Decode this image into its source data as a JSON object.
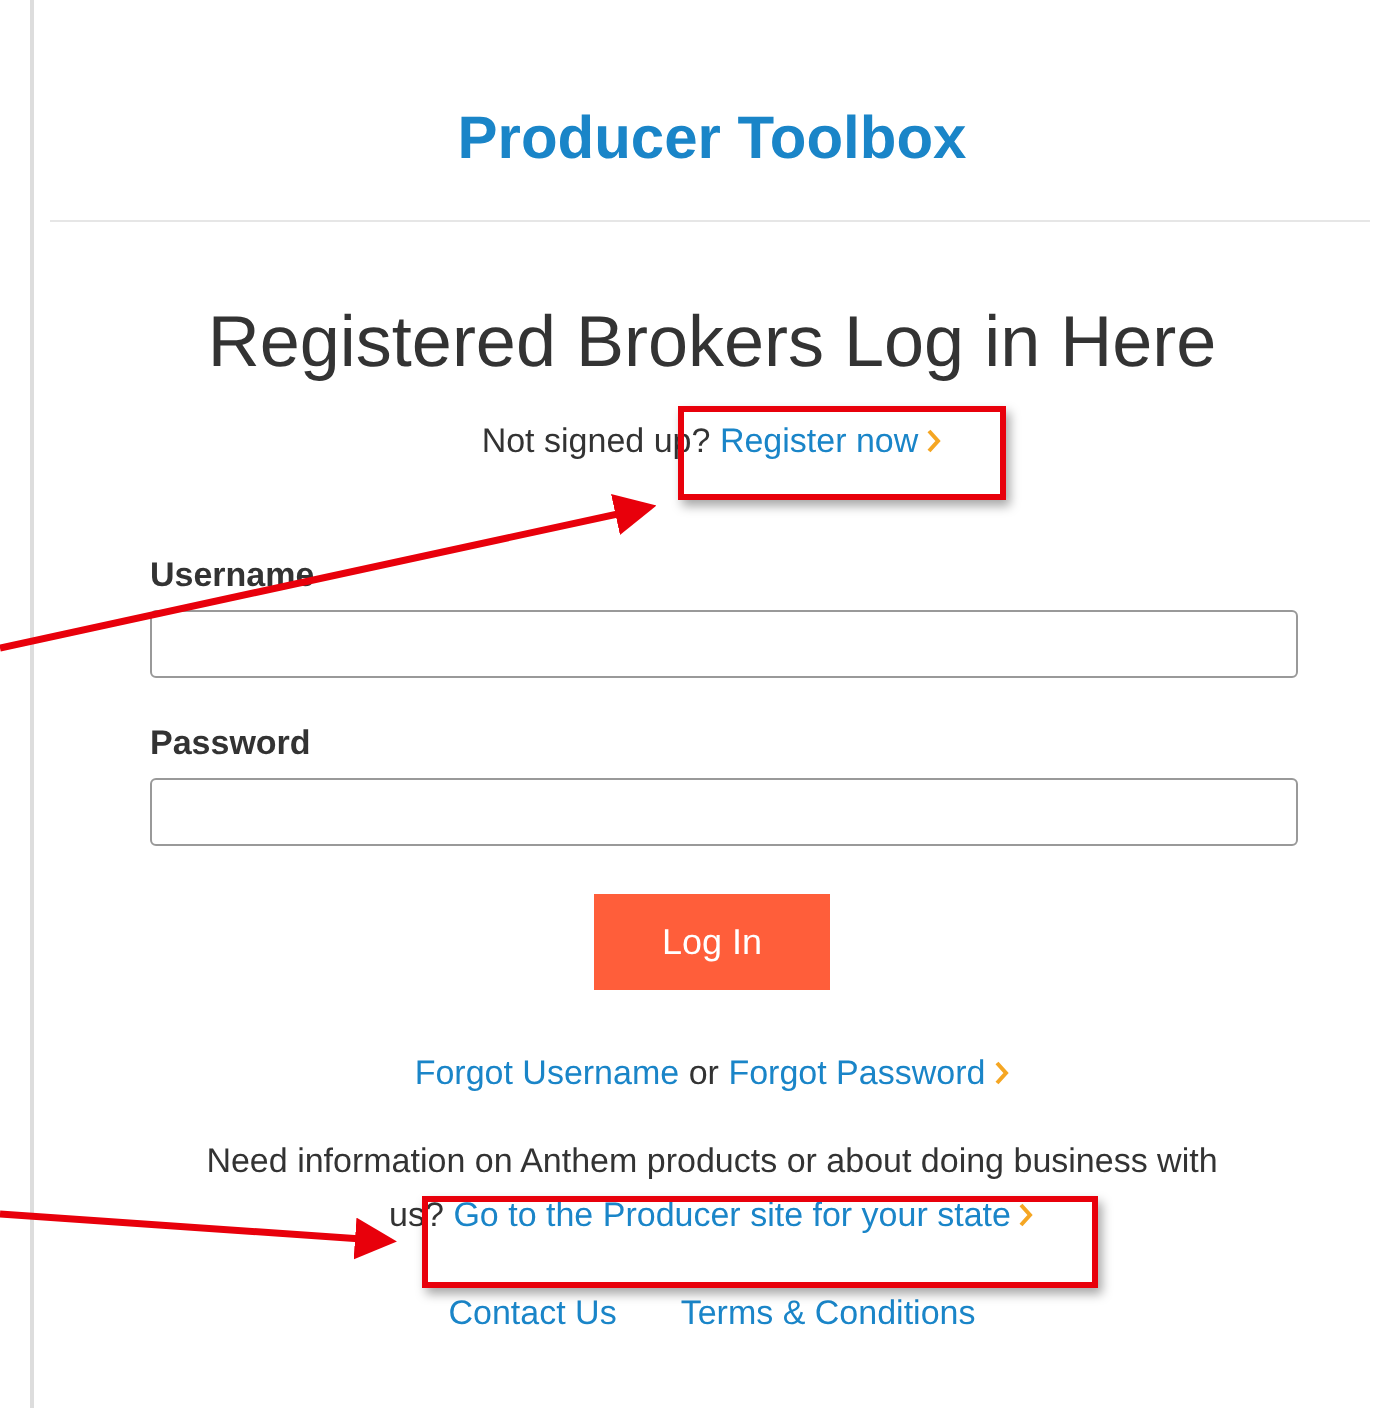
{
  "title": "Producer Toolbox",
  "heading": "Registered Brokers Log in Here",
  "signup": {
    "text": "Not signed up?",
    "link": "Register now"
  },
  "fields": [
    {
      "label": "Username"
    },
    {
      "label": "Password"
    }
  ],
  "login_button": "Log In",
  "recovery": {
    "links": [
      "Forgot Username",
      "Forgot Password"
    ],
    "separator": "or"
  },
  "info": {
    "text": "Need information on Anthem products or about doing business with us?",
    "link": "Go to the Producer site for your state"
  },
  "footer_links": [
    "Contact Us",
    "Terms & Conditions"
  ]
}
